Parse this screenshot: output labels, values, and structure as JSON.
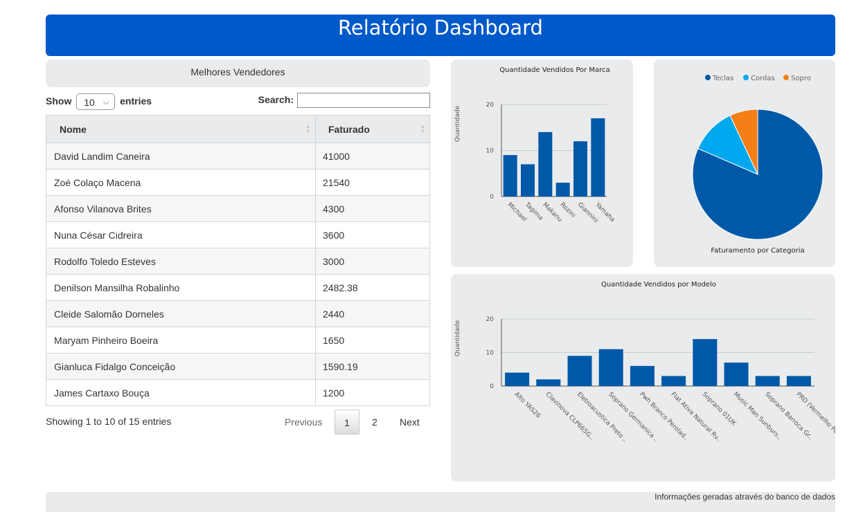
{
  "header": {
    "title": "Relatório Dashboard"
  },
  "sellers_panel": {
    "title": "Melhores Vendedores"
  },
  "table_controls": {
    "show_label": "Show",
    "entries_value": "10",
    "entries_label": "entries",
    "search_label": "Search:",
    "search_value": ""
  },
  "table": {
    "columns": [
      "Nome",
      "Faturado"
    ],
    "rows": [
      [
        "David Landim Caneira",
        "41000"
      ],
      [
        "Zoé Colaço Macena",
        "21540"
      ],
      [
        "Afonso Vilanova Brites",
        "4300"
      ],
      [
        "Nuna César Cidreira",
        "3600"
      ],
      [
        "Rodolfo Toledo Esteves",
        "3000"
      ],
      [
        "Denilson Mansilha Robalinho",
        "2482.38"
      ],
      [
        "Cleide Salomão Dorneles",
        "2440"
      ],
      [
        "Maryam Pinheiro Boeira",
        "1650"
      ],
      [
        "Gianluca Fidalgo Conceição",
        "1590.19"
      ],
      [
        "James Cartaxo Bouça",
        "1200"
      ]
    ]
  },
  "table_info": "Showing 1 to 10 of 15 entries",
  "pagination": {
    "previous": "Previous",
    "pages": [
      "1",
      "2"
    ],
    "current": "1",
    "next": "Next"
  },
  "footer": {
    "text": "Informações geradas através do banco de dados"
  },
  "colors": {
    "header": "#0059c9",
    "bar": "#0059a8",
    "teclas": "#0059a8",
    "cordas": "#00a8f0",
    "sopro": "#f57f17",
    "panel": "#e9ebec"
  },
  "chart_data": [
    {
      "type": "bar",
      "title": "Quantidade Vendidos Por Marca",
      "ylabel": "Quantidade",
      "xlabel": "",
      "categories": [
        "Michael",
        "Tagima",
        "Makanu",
        "Rozini",
        "Giannini",
        "Yamaha"
      ],
      "values": [
        9,
        7,
        14,
        3,
        12,
        17
      ],
      "ylim": [
        0,
        20
      ],
      "yticks": [
        0,
        10,
        20
      ],
      "grid": true
    },
    {
      "type": "pie",
      "title": "Faturamento por Categoria",
      "labels": [
        "Teclas",
        "Cordas",
        "Sopro"
      ],
      "values": [
        81.5,
        11.5,
        7
      ],
      "legend": "top"
    },
    {
      "type": "bar",
      "title": "Quantidade Vendidos por Modelo",
      "ylabel": "Quantidade",
      "xlabel": "",
      "categories": [
        "Alto YAS26",
        "Clavinova CLP665G..",
        "Eletroacustica Preto ..",
        "Soprano Germanica ..",
        "Pwh Branco Perolad..",
        "Flat Ativa Natural Rv..",
        "Soprano 01UK",
        "Music Man Sunburs..",
        "Soprano Barroca Gr..",
        "PRD (Vermelho Pero.."
      ],
      "values": [
        4,
        2,
        9,
        11,
        6,
        3,
        14,
        7,
        3,
        3
      ],
      "ylim": [
        0,
        20
      ],
      "yticks": [
        0,
        10,
        20
      ],
      "grid": true
    }
  ]
}
